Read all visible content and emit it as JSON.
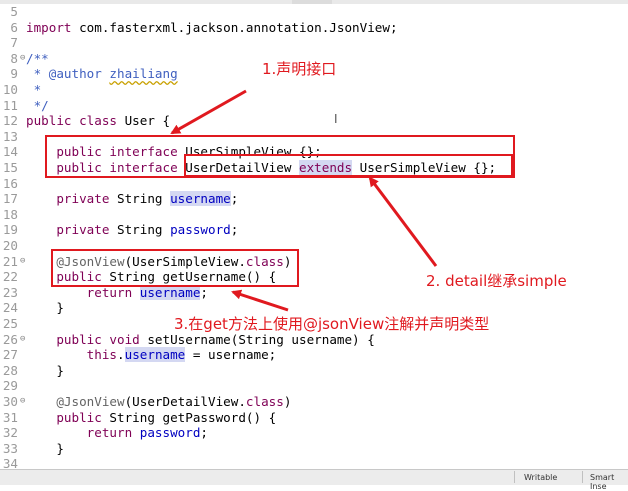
{
  "lines": [
    {
      "n": "5",
      "fold": "",
      "seg": []
    },
    {
      "n": "6",
      "fold": "",
      "seg": [
        {
          "t": "import ",
          "c": "kw"
        },
        {
          "t": "com.fasterxml.jackson.annotation.JsonView;"
        }
      ]
    },
    {
      "n": "7",
      "fold": "",
      "seg": []
    },
    {
      "n": "8",
      "fold": "⊖",
      "seg": [
        {
          "t": "/**",
          "c": "cm"
        }
      ]
    },
    {
      "n": "9",
      "fold": "",
      "seg": [
        {
          "t": " * @author ",
          "c": "cm"
        },
        {
          "t": "zhailiang",
          "c": "cm us"
        }
      ]
    },
    {
      "n": "10",
      "fold": "",
      "seg": [
        {
          "t": " *",
          "c": "cm"
        }
      ]
    },
    {
      "n": "11",
      "fold": "",
      "seg": [
        {
          "t": " */",
          "c": "cm"
        }
      ]
    },
    {
      "n": "12",
      "fold": "",
      "seg": [
        {
          "t": "public class ",
          "c": "kw"
        },
        {
          "t": "User {"
        }
      ]
    },
    {
      "n": "13",
      "fold": "",
      "seg": []
    },
    {
      "n": "14",
      "fold": "",
      "seg": [
        {
          "t": "    "
        },
        {
          "t": "public interface ",
          "c": "kw"
        },
        {
          "t": "UserSimpleView {};"
        }
      ]
    },
    {
      "n": "15",
      "fold": "",
      "seg": [
        {
          "t": "    "
        },
        {
          "t": "public interface ",
          "c": "kw"
        },
        {
          "t": "UserDetailView "
        },
        {
          "t": "extends",
          "c": "kw hl"
        },
        {
          "t": " UserSimpleView {};"
        }
      ]
    },
    {
      "n": "16",
      "fold": "",
      "seg": []
    },
    {
      "n": "17",
      "fold": "",
      "seg": [
        {
          "t": "    "
        },
        {
          "t": "private ",
          "c": "kw"
        },
        {
          "t": "String "
        },
        {
          "t": "username",
          "c": "fld hl"
        },
        {
          "t": ";"
        }
      ]
    },
    {
      "n": "18",
      "fold": "",
      "seg": []
    },
    {
      "n": "19",
      "fold": "",
      "seg": [
        {
          "t": "    "
        },
        {
          "t": "private ",
          "c": "kw"
        },
        {
          "t": "String "
        },
        {
          "t": "password",
          "c": "fld"
        },
        {
          "t": ";"
        }
      ]
    },
    {
      "n": "20",
      "fold": "",
      "seg": []
    },
    {
      "n": "21",
      "fold": "⊖",
      "seg": [
        {
          "t": "    "
        },
        {
          "t": "@JsonView",
          "c": "an"
        },
        {
          "t": "(UserSimpleView."
        },
        {
          "t": "class",
          "c": "kw"
        },
        {
          "t": ")"
        }
      ]
    },
    {
      "n": "22",
      "fold": "",
      "seg": [
        {
          "t": "    "
        },
        {
          "t": "public ",
          "c": "kw"
        },
        {
          "t": "String getUsername() {"
        }
      ]
    },
    {
      "n": "23",
      "fold": "",
      "seg": [
        {
          "t": "        "
        },
        {
          "t": "return ",
          "c": "kw"
        },
        {
          "t": "username",
          "c": "fld hl"
        },
        {
          "t": ";"
        }
      ]
    },
    {
      "n": "24",
      "fold": "",
      "seg": [
        {
          "t": "    }"
        }
      ]
    },
    {
      "n": "25",
      "fold": "",
      "seg": []
    },
    {
      "n": "26",
      "fold": "⊖",
      "seg": [
        {
          "t": "    "
        },
        {
          "t": "public void ",
          "c": "kw"
        },
        {
          "t": "setUsername(String username) {"
        }
      ]
    },
    {
      "n": "27",
      "fold": "",
      "seg": [
        {
          "t": "        "
        },
        {
          "t": "this",
          "c": "kw"
        },
        {
          "t": "."
        },
        {
          "t": "username",
          "c": "fld hl"
        },
        {
          "t": " = username;"
        }
      ]
    },
    {
      "n": "28",
      "fold": "",
      "seg": [
        {
          "t": "    }"
        }
      ]
    },
    {
      "n": "29",
      "fold": "",
      "seg": []
    },
    {
      "n": "30",
      "fold": "⊖",
      "seg": [
        {
          "t": "    "
        },
        {
          "t": "@JsonView",
          "c": "an"
        },
        {
          "t": "(UserDetailView."
        },
        {
          "t": "class",
          "c": "kw"
        },
        {
          "t": ")"
        }
      ]
    },
    {
      "n": "31",
      "fold": "",
      "seg": [
        {
          "t": "    "
        },
        {
          "t": "public ",
          "c": "kw"
        },
        {
          "t": "String getPassword() {"
        }
      ]
    },
    {
      "n": "32",
      "fold": "",
      "seg": [
        {
          "t": "        "
        },
        {
          "t": "return ",
          "c": "kw"
        },
        {
          "t": "password",
          "c": "fld"
        },
        {
          "t": ";"
        }
      ]
    },
    {
      "n": "33",
      "fold": "",
      "seg": [
        {
          "t": "    }"
        }
      ]
    },
    {
      "n": "34",
      "fold": "",
      "seg": []
    }
  ],
  "annotations": {
    "a1": "1.声明接口",
    "a2": "2. detail继承simple",
    "a3": "3.在get方法上使用@jsonView注解并声明类型"
  },
  "status": {
    "writable": "Writable",
    "insert_mode": "Smart Inse"
  },
  "colors": {
    "annotation_red": "#e0191f",
    "keyword": "#7f0055",
    "field": "#0000c0",
    "comment": "#3f5fbf"
  }
}
